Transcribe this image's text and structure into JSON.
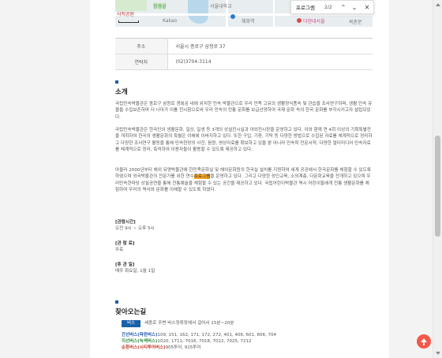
{
  "map": {
    "labels": [
      {
        "text": "창경궁",
        "cls": "green"
      },
      {
        "text": "서울대학교",
        "cls": ""
      },
      {
        "text": "사직공원",
        "cls": "red"
      },
      {
        "text": "Kakao",
        "cls": ""
      },
      {
        "text": "혜화역",
        "cls": ""
      },
      {
        "text": "더현대서울",
        "cls": "pink"
      },
      {
        "text": "북촌문",
        "cls": ""
      }
    ]
  },
  "find": {
    "query": "프로그램",
    "count": "2/2",
    "prev_glyph": "⌃",
    "next_glyph": "⌄",
    "close_glyph": "✕"
  },
  "info": {
    "rows": [
      {
        "label": "주소",
        "value": "서울시 종로구 삼청로 37"
      },
      {
        "label": "연락처",
        "value": "(02)3704-3114"
      }
    ]
  },
  "intro": {
    "title": "소개",
    "p1": "국립민속박물관은 종로구 삼청로 경복궁 내에 위치한 민속 박물관으로 우리 민족 고유의 생활양식풍속 및 관습을 조사연구하며, 생활 민속 유물을 수집보존하며 더 나아가 이를 전시함으로써 우리 민속의 전통 문화를 보급선양하여 국제 문화 속의 한국 문화를 부각시키고자 설립되었다.",
    "p2": "국립민속박물관은 한국인의 생활문화, 일상, 일생 등 3개의 상설전시실과 야외전시장을 운영하고 있다. 이와 함께 연 4회 이상의 기획특별전을 개최하여 한국의 생활문화의 특별은 이해에 이바지하고 있다. 또한 구입, 기증, 기탁 등 다양한 방법으로 수집된 자료를 체계적으로 정리하고 다양한 조사연구 활동을 통해 민속현장의 사진, 음원, 영상자료를 확보하고 있을 뿐 아니라 민속학 전문서적, 다양한 멀티미디어 민속자료를 체계적으로 정리, 축적하여 이용자들이 활용할 수 있도록 제공하고 있다.",
    "p3_before": "아울러 2000년부터 해외 유명박물관에 한민족문화실 및 해외문화원의 한국실 설치를 지원하여 세계 공공에서 한국문화를 체험할 수 있도록 하였으며 외국박물관의 전문가를 위한 연수",
    "p3_highlight": "프로그램",
    "p3_after": "을 운영하고 있다. 그리고 다양한 성인교육, 소외계층, 다문화교육을 전개하고 있으며 우리민속한마당 상설공연을 통해 전통예술을 체험할 수 있는 공간을 제공하고 있다. 국립어린이박물관 역시 어린이들에게 전통 생활문화를 체험하여 우리의 역사와 문화를 이해할 수 있도록 하였다."
  },
  "hours": {
    "label": "[관람시간]",
    "value": "오전 9시 ~ 오후 5시"
  },
  "fee": {
    "label": "[관 람 료]",
    "value": "무료"
  },
  "closed": {
    "label": "[휴 관 일]",
    "value": "매주 화요일, 1월 1일"
  },
  "directions": {
    "title": "찾아오는길",
    "bus_badge": "버스",
    "bus_desc": "세종로 주변 버스정류장에서 걸어서 15분~20분",
    "lines": [
      {
        "name": "간선버스(파란버스)",
        "cls": "blue",
        "numbers": "109, 151, 162, 171, 172, 272, 401, 406, 601, 606, 704"
      },
      {
        "name": "지선버스(녹색버스)",
        "cls": "green",
        "numbers": "1020, 1711, 7016, 7018, 7022, 7025, 7212"
      },
      {
        "name": "순환버스(시티투어버스)",
        "cls": "red",
        "numbers": "905투어, 915투어"
      }
    ]
  },
  "colors": {
    "accent": "#1a5fa8",
    "highlight": "#f5a623",
    "top_button": "#f2594b"
  }
}
